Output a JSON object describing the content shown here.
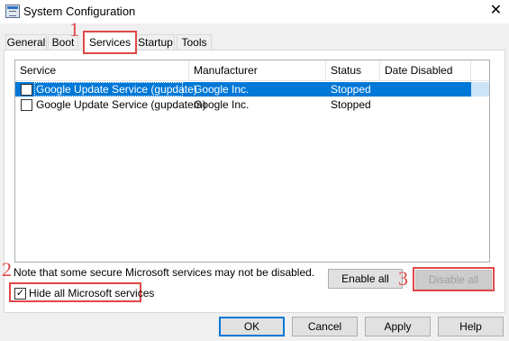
{
  "window": {
    "title": "System Configuration",
    "close_glyph": "✕"
  },
  "tabs": [
    {
      "label": "General"
    },
    {
      "label": "Boot"
    },
    {
      "label": "Services",
      "active": true
    },
    {
      "label": "Startup"
    },
    {
      "label": "Tools"
    }
  ],
  "services_list": {
    "columns": [
      "Service",
      "Manufacturer",
      "Status",
      "Date Disabled"
    ],
    "rows": [
      {
        "checked": false,
        "selected": true,
        "service": "Google Update Service (gupdate)",
        "manufacturer": "Google Inc.",
        "status": "Stopped",
        "date_disabled": ""
      },
      {
        "checked": false,
        "selected": false,
        "service": "Google Update Service (gupdatem)",
        "manufacturer": "Google Inc.",
        "status": "Stopped",
        "date_disabled": ""
      }
    ]
  },
  "note": "Note that some secure Microsoft services may not be disabled.",
  "hide_microsoft": {
    "label": "Hide all Microsoft services",
    "checked": true,
    "check_glyph": "✓"
  },
  "buttons": {
    "enable_all": "Enable all",
    "disable_all": "Disable all",
    "ok": "OK",
    "cancel": "Cancel",
    "apply": "Apply",
    "help": "Help"
  },
  "annotations": {
    "step1": "1",
    "step2": "2",
    "step3": "3",
    "color": "#e04848"
  },
  "colors": {
    "selection": "#0078d7",
    "annotation_red": "#e04848"
  }
}
